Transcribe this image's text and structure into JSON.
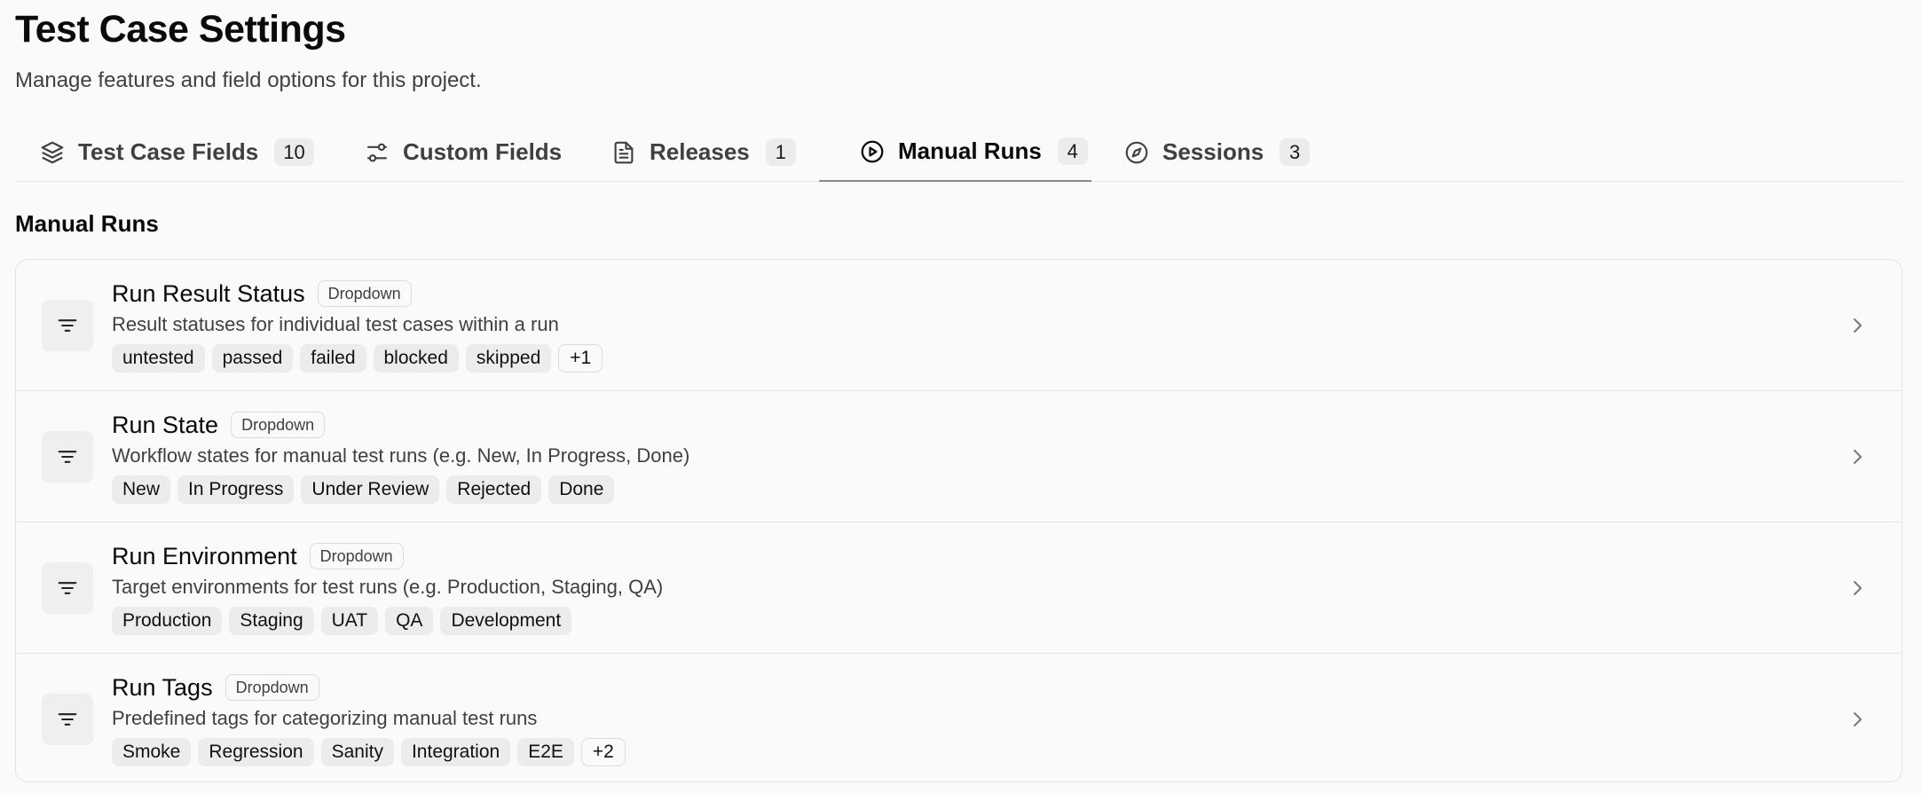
{
  "header": {
    "title": "Test Case Settings",
    "subtitle": "Manage features and field options for this project."
  },
  "tabs": [
    {
      "label": "Test Case Fields",
      "count": "10",
      "icon": "layers-icon",
      "active": false
    },
    {
      "label": "Custom Fields",
      "count": "",
      "icon": "sliders-icon",
      "active": false
    },
    {
      "label": "Releases",
      "count": "1",
      "icon": "document-icon",
      "active": false
    },
    {
      "label": "Manual Runs",
      "count": "4",
      "icon": "play-circle-icon",
      "active": true
    },
    {
      "label": "Sessions",
      "count": "3",
      "icon": "compass-icon",
      "active": false
    }
  ],
  "section": {
    "title": "Manual Runs"
  },
  "fields": [
    {
      "name": "Run Result Status",
      "type": "Dropdown",
      "description": "Result statuses for individual test cases within a run",
      "options": [
        "untested",
        "passed",
        "failed",
        "blocked",
        "skipped"
      ],
      "more": "+1",
      "icon": "filter-lines-icon"
    },
    {
      "name": "Run State",
      "type": "Dropdown",
      "description": "Workflow states for manual test runs (e.g. New, In Progress, Done)",
      "options": [
        "New",
        "In Progress",
        "Under Review",
        "Rejected",
        "Done"
      ],
      "more": "",
      "icon": "filter-lines-icon"
    },
    {
      "name": "Run Environment",
      "type": "Dropdown",
      "description": "Target environments for test runs (e.g. Production, Staging, QA)",
      "options": [
        "Production",
        "Staging",
        "UAT",
        "QA",
        "Development"
      ],
      "more": "",
      "icon": "filter-lines-icon"
    },
    {
      "name": "Run Tags",
      "type": "Dropdown",
      "description": "Predefined tags for categorizing manual test runs",
      "options": [
        "Smoke",
        "Regression",
        "Sanity",
        "Integration",
        "E2E"
      ],
      "more": "+2",
      "icon": "filter-lines-icon"
    }
  ],
  "colors": {
    "background": "#fafafa",
    "border": "#e3e3e3",
    "chip": "#ececec",
    "text": "#0a0a0a",
    "muted": "#404040"
  }
}
